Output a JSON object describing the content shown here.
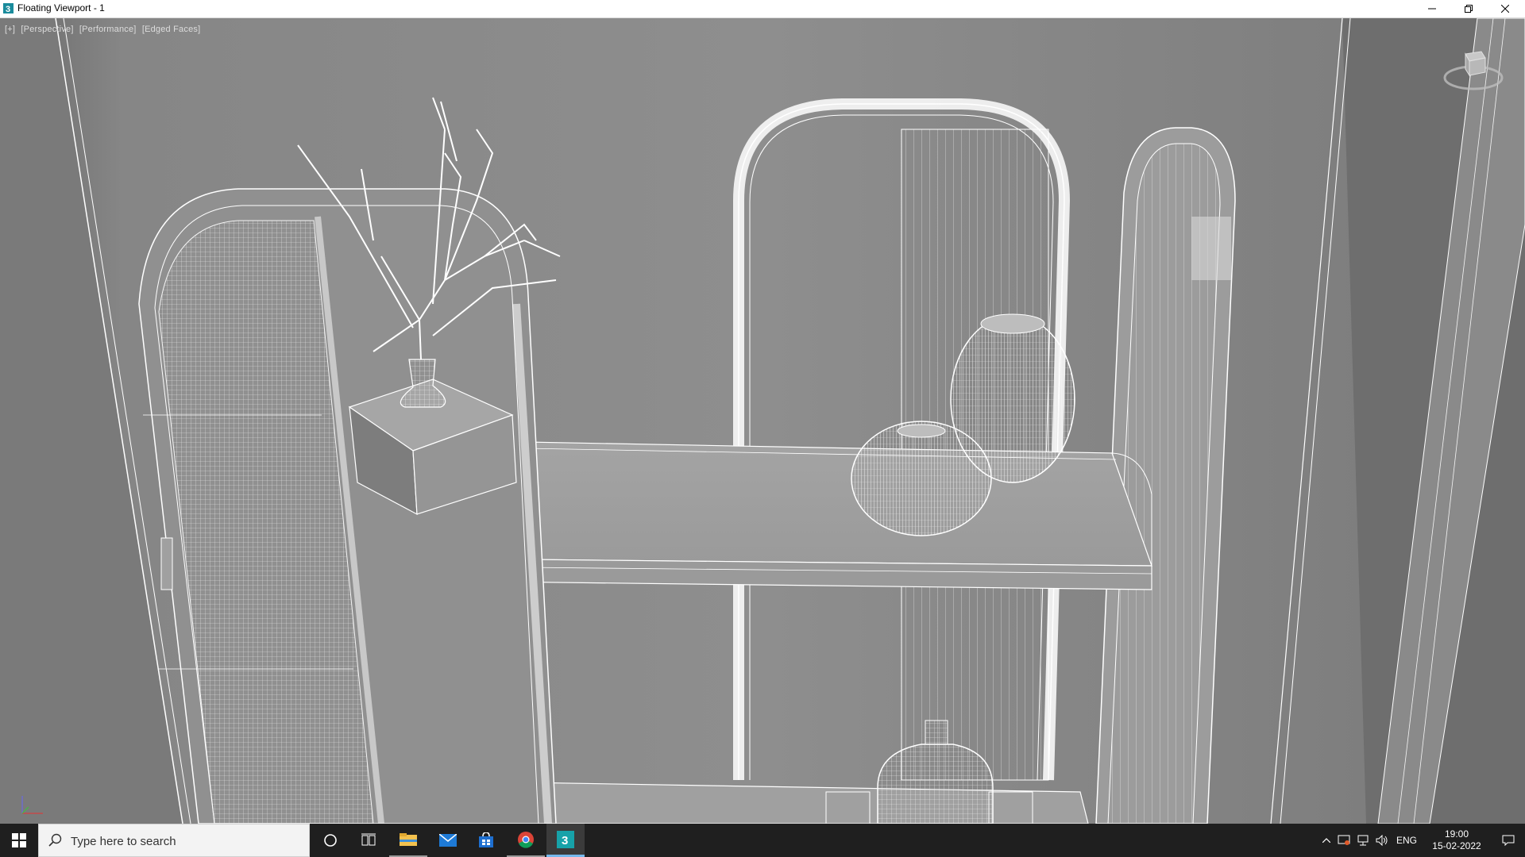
{
  "window": {
    "title": "Floating Viewport - 1",
    "icon": "3dsmax-app-icon",
    "controls": [
      "minimize-icon",
      "restore-icon",
      "close-icon"
    ]
  },
  "viewport": {
    "labels": [
      "[+]",
      "[Perspective]",
      "[Performance]",
      "[Edged Faces]"
    ],
    "background_color": "#8c8c8c",
    "wire_color": "#ffffff"
  },
  "taskbar": {
    "search_placeholder": "Type here to search",
    "apps": [
      "cortana-icon",
      "task-view-icon",
      "file-explorer-icon",
      "mail-icon",
      "store-icon",
      "chrome-icon",
      "3dsmax-taskbar-icon"
    ],
    "tray": {
      "language": "ENG",
      "time": "19:00",
      "date": "15-02-2022"
    }
  }
}
